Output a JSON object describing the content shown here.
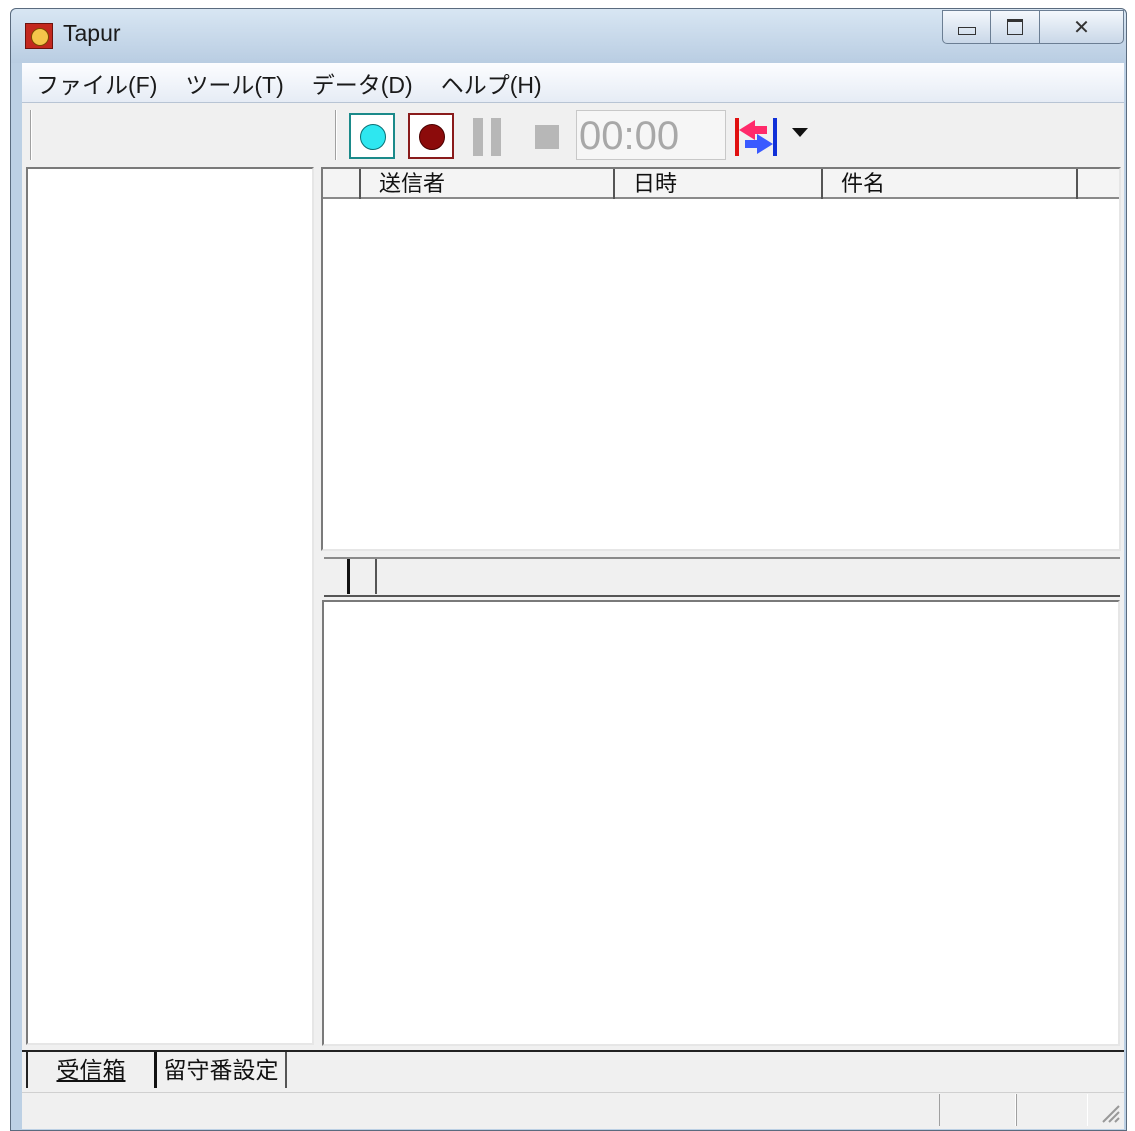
{
  "window": {
    "title": "Tapur"
  },
  "menu": {
    "items": [
      "ファイル(F)",
      "ツール(T)",
      "データ(D)",
      "ヘルプ(H)"
    ]
  },
  "toolbar": {
    "timer": "00:00"
  },
  "message_list": {
    "columns": [
      "",
      "送信者",
      "日時",
      "件名"
    ],
    "rows": []
  },
  "tabs": [
    {
      "label": "受信箱",
      "active": true
    },
    {
      "label": "留守番設定",
      "active": false
    }
  ],
  "colors": {
    "record_cyan": "#2ee7f0",
    "record_red": "#8c0b0b"
  }
}
